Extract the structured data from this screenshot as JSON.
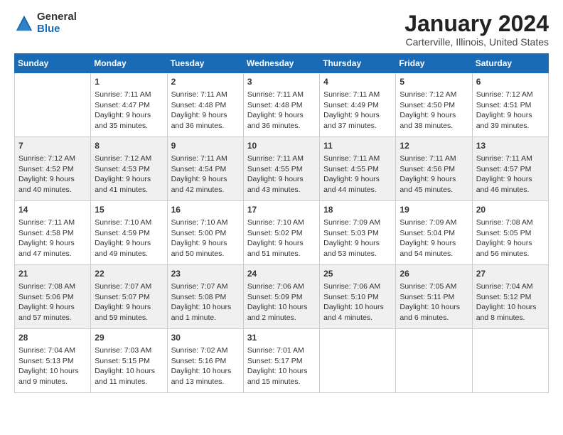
{
  "header": {
    "logo_general": "General",
    "logo_blue": "Blue",
    "month_title": "January 2024",
    "subtitle": "Carterville, Illinois, United States"
  },
  "days_of_week": [
    "Sunday",
    "Monday",
    "Tuesday",
    "Wednesday",
    "Thursday",
    "Friday",
    "Saturday"
  ],
  "weeks": [
    [
      {
        "day": "",
        "info": ""
      },
      {
        "day": "1",
        "info": "Sunrise: 7:11 AM\nSunset: 4:47 PM\nDaylight: 9 hours\nand 35 minutes."
      },
      {
        "day": "2",
        "info": "Sunrise: 7:11 AM\nSunset: 4:48 PM\nDaylight: 9 hours\nand 36 minutes."
      },
      {
        "day": "3",
        "info": "Sunrise: 7:11 AM\nSunset: 4:48 PM\nDaylight: 9 hours\nand 36 minutes."
      },
      {
        "day": "4",
        "info": "Sunrise: 7:11 AM\nSunset: 4:49 PM\nDaylight: 9 hours\nand 37 minutes."
      },
      {
        "day": "5",
        "info": "Sunrise: 7:12 AM\nSunset: 4:50 PM\nDaylight: 9 hours\nand 38 minutes."
      },
      {
        "day": "6",
        "info": "Sunrise: 7:12 AM\nSunset: 4:51 PM\nDaylight: 9 hours\nand 39 minutes."
      }
    ],
    [
      {
        "day": "7",
        "info": "Sunrise: 7:12 AM\nSunset: 4:52 PM\nDaylight: 9 hours\nand 40 minutes."
      },
      {
        "day": "8",
        "info": "Sunrise: 7:12 AM\nSunset: 4:53 PM\nDaylight: 9 hours\nand 41 minutes."
      },
      {
        "day": "9",
        "info": "Sunrise: 7:11 AM\nSunset: 4:54 PM\nDaylight: 9 hours\nand 42 minutes."
      },
      {
        "day": "10",
        "info": "Sunrise: 7:11 AM\nSunset: 4:55 PM\nDaylight: 9 hours\nand 43 minutes."
      },
      {
        "day": "11",
        "info": "Sunrise: 7:11 AM\nSunset: 4:55 PM\nDaylight: 9 hours\nand 44 minutes."
      },
      {
        "day": "12",
        "info": "Sunrise: 7:11 AM\nSunset: 4:56 PM\nDaylight: 9 hours\nand 45 minutes."
      },
      {
        "day": "13",
        "info": "Sunrise: 7:11 AM\nSunset: 4:57 PM\nDaylight: 9 hours\nand 46 minutes."
      }
    ],
    [
      {
        "day": "14",
        "info": "Sunrise: 7:11 AM\nSunset: 4:58 PM\nDaylight: 9 hours\nand 47 minutes."
      },
      {
        "day": "15",
        "info": "Sunrise: 7:10 AM\nSunset: 4:59 PM\nDaylight: 9 hours\nand 49 minutes."
      },
      {
        "day": "16",
        "info": "Sunrise: 7:10 AM\nSunset: 5:00 PM\nDaylight: 9 hours\nand 50 minutes."
      },
      {
        "day": "17",
        "info": "Sunrise: 7:10 AM\nSunset: 5:02 PM\nDaylight: 9 hours\nand 51 minutes."
      },
      {
        "day": "18",
        "info": "Sunrise: 7:09 AM\nSunset: 5:03 PM\nDaylight: 9 hours\nand 53 minutes."
      },
      {
        "day": "19",
        "info": "Sunrise: 7:09 AM\nSunset: 5:04 PM\nDaylight: 9 hours\nand 54 minutes."
      },
      {
        "day": "20",
        "info": "Sunrise: 7:08 AM\nSunset: 5:05 PM\nDaylight: 9 hours\nand 56 minutes."
      }
    ],
    [
      {
        "day": "21",
        "info": "Sunrise: 7:08 AM\nSunset: 5:06 PM\nDaylight: 9 hours\nand 57 minutes."
      },
      {
        "day": "22",
        "info": "Sunrise: 7:07 AM\nSunset: 5:07 PM\nDaylight: 9 hours\nand 59 minutes."
      },
      {
        "day": "23",
        "info": "Sunrise: 7:07 AM\nSunset: 5:08 PM\nDaylight: 10 hours\nand 1 minute."
      },
      {
        "day": "24",
        "info": "Sunrise: 7:06 AM\nSunset: 5:09 PM\nDaylight: 10 hours\nand 2 minutes."
      },
      {
        "day": "25",
        "info": "Sunrise: 7:06 AM\nSunset: 5:10 PM\nDaylight: 10 hours\nand 4 minutes."
      },
      {
        "day": "26",
        "info": "Sunrise: 7:05 AM\nSunset: 5:11 PM\nDaylight: 10 hours\nand 6 minutes."
      },
      {
        "day": "27",
        "info": "Sunrise: 7:04 AM\nSunset: 5:12 PM\nDaylight: 10 hours\nand 8 minutes."
      }
    ],
    [
      {
        "day": "28",
        "info": "Sunrise: 7:04 AM\nSunset: 5:13 PM\nDaylight: 10 hours\nand 9 minutes."
      },
      {
        "day": "29",
        "info": "Sunrise: 7:03 AM\nSunset: 5:15 PM\nDaylight: 10 hours\nand 11 minutes."
      },
      {
        "day": "30",
        "info": "Sunrise: 7:02 AM\nSunset: 5:16 PM\nDaylight: 10 hours\nand 13 minutes."
      },
      {
        "day": "31",
        "info": "Sunrise: 7:01 AM\nSunset: 5:17 PM\nDaylight: 10 hours\nand 15 minutes."
      },
      {
        "day": "",
        "info": ""
      },
      {
        "day": "",
        "info": ""
      },
      {
        "day": "",
        "info": ""
      }
    ]
  ]
}
